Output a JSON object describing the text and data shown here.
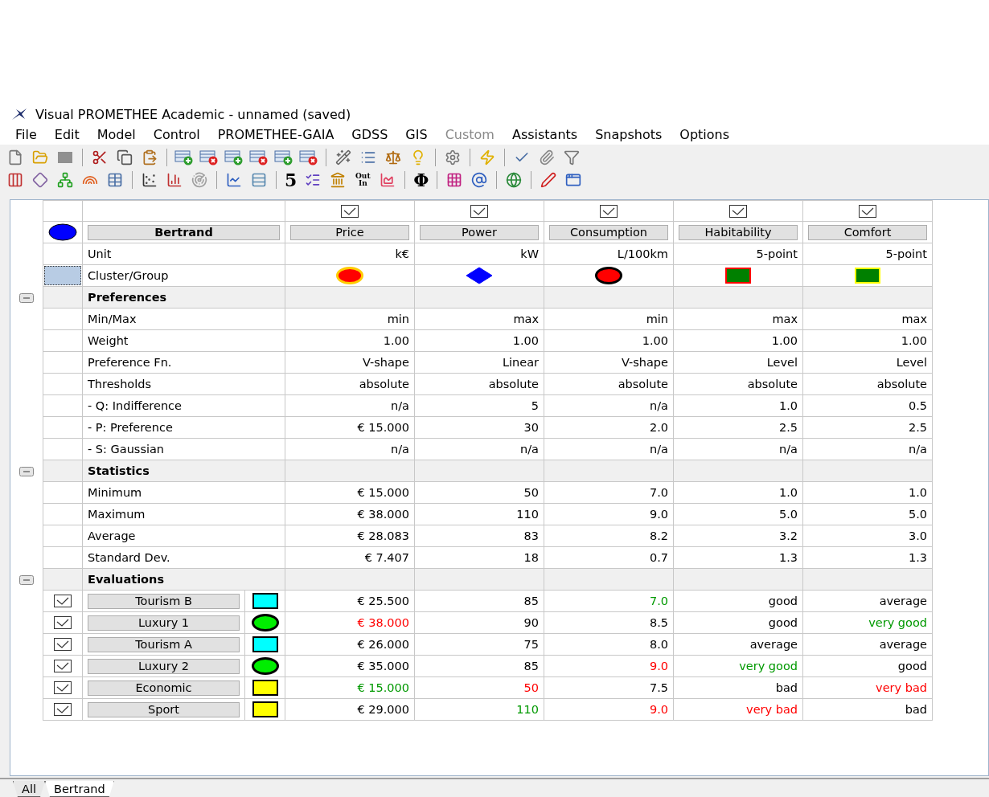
{
  "window": {
    "title": "Visual PROMETHEE Academic - unnamed (saved)"
  },
  "menu": [
    {
      "label": "File",
      "disabled": false
    },
    {
      "label": "Edit",
      "disabled": false
    },
    {
      "label": "Model",
      "disabled": false
    },
    {
      "label": "Control",
      "disabled": false
    },
    {
      "label": "PROMETHEE-GAIA",
      "disabled": false
    },
    {
      "label": "GDSS",
      "disabled": false
    },
    {
      "label": "GIS",
      "disabled": false
    },
    {
      "label": "Custom",
      "disabled": true
    },
    {
      "label": "Assistants",
      "disabled": false
    },
    {
      "label": "Snapshots",
      "disabled": false
    },
    {
      "label": "Options",
      "disabled": false
    }
  ],
  "toolbars": [
    [
      {
        "kind": "icon"
      },
      {
        "kind": "icon"
      },
      {
        "kind": "icon"
      },
      {
        "kind": "separator"
      },
      {
        "kind": "icon"
      },
      {
        "kind": "icon"
      },
      {
        "kind": "icon"
      },
      {
        "kind": "separator"
      },
      {
        "kind": "icon"
      },
      {
        "kind": "icon"
      },
      {
        "kind": "icon"
      },
      {
        "kind": "icon"
      },
      {
        "kind": "icon"
      },
      {
        "kind": "icon"
      },
      {
        "kind": "separator"
      },
      {
        "kind": "icon"
      },
      {
        "kind": "icon"
      },
      {
        "kind": "icon"
      },
      {
        "kind": "icon"
      },
      {
        "kind": "separator"
      },
      {
        "kind": "icon"
      },
      {
        "kind": "separator"
      },
      {
        "kind": "icon"
      },
      {
        "kind": "separator"
      },
      {
        "kind": "icon"
      },
      {
        "kind": "icon"
      },
      {
        "kind": "icon"
      }
    ],
    [
      {
        "kind": "icon"
      },
      {
        "kind": "icon"
      },
      {
        "kind": "icon"
      },
      {
        "kind": "icon"
      },
      {
        "kind": "icon"
      },
      {
        "kind": "separator"
      },
      {
        "kind": "icon"
      },
      {
        "kind": "icon"
      },
      {
        "kind": "icon"
      },
      {
        "kind": "separator"
      },
      {
        "kind": "icon"
      },
      {
        "kind": "icon"
      },
      {
        "kind": "separator"
      },
      {
        "kind": "glyph",
        "label": "5"
      },
      {
        "kind": "icon"
      },
      {
        "kind": "icon"
      },
      {
        "kind": "glyph",
        "label": "Out In"
      },
      {
        "kind": "icon"
      },
      {
        "kind": "separator"
      },
      {
        "kind": "glyph",
        "label": "Φ"
      },
      {
        "kind": "separator"
      },
      {
        "kind": "icon"
      },
      {
        "kind": "icon"
      },
      {
        "kind": "separator"
      },
      {
        "kind": "icon"
      },
      {
        "kind": "separator"
      },
      {
        "kind": "icon"
      },
      {
        "kind": "icon"
      }
    ]
  ],
  "scenario": {
    "name": "Bertrand",
    "color": "#0000ff"
  },
  "unit_label": "Unit",
  "cluster_label": "Cluster/Group",
  "criteria": [
    {
      "name": "Price",
      "checked": true,
      "unit": "k€",
      "cluster": {
        "kind": "circle",
        "color": "#ff0000",
        "outline": {
          "color": "#ffcc00"
        }
      }
    },
    {
      "name": "Power",
      "checked": true,
      "unit": "kW",
      "cluster": {
        "kind": "diamond",
        "color": "#0000ff",
        "outline": {
          "color": "#0000ff"
        }
      }
    },
    {
      "name": "Consumption",
      "checked": true,
      "unit": "L/100km",
      "cluster": {
        "kind": "circle",
        "color": "#ff0000",
        "outline": {
          "color": "#000000"
        }
      }
    },
    {
      "name": "Habitability",
      "checked": true,
      "unit": "5-point",
      "cluster": {
        "kind": "square",
        "color": "#008000",
        "outline": {
          "color": "#ff0000"
        }
      }
    },
    {
      "name": "Comfort",
      "checked": true,
      "unit": "5-point",
      "cluster": {
        "kind": "square",
        "color": "#008000",
        "outline": {
          "color": "#ffff00"
        }
      }
    }
  ],
  "sections": [
    {
      "title": "Preferences",
      "expanded": true,
      "rows": [
        {
          "label": "Min/Max",
          "cells": [
            "min",
            "max",
            "min",
            "max",
            "max"
          ]
        },
        {
          "label": "Weight",
          "cells": [
            "1.00",
            "1.00",
            "1.00",
            "1.00",
            "1.00"
          ]
        },
        {
          "label": "Preference Fn.",
          "cells": [
            "V-shape",
            "Linear",
            "V-shape",
            "Level",
            "Level"
          ]
        },
        {
          "label": "Thresholds",
          "cells": [
            "absolute",
            "absolute",
            "absolute",
            "absolute",
            "absolute"
          ]
        },
        {
          "label": "- Q: Indifference",
          "cells": [
            "n/a",
            "5",
            "n/a",
            "1.0",
            "0.5"
          ]
        },
        {
          "label": "- P: Preference",
          "cells": [
            "€ 15.000",
            "30",
            "2.0",
            "2.5",
            "2.5"
          ]
        },
        {
          "label": "- S: Gaussian",
          "cells": [
            "n/a",
            "n/a",
            "n/a",
            "n/a",
            "n/a"
          ]
        }
      ]
    },
    {
      "title": "Statistics",
      "expanded": true,
      "rows": [
        {
          "label": "Minimum",
          "cells": [
            "€ 15.000",
            "50",
            "7.0",
            "1.0",
            "1.0"
          ]
        },
        {
          "label": "Maximum",
          "cells": [
            "€ 38.000",
            "110",
            "9.0",
            "5.0",
            "5.0"
          ]
        },
        {
          "label": "Average",
          "cells": [
            "€ 28.083",
            "83",
            "8.2",
            "3.2",
            "3.0"
          ]
        },
        {
          "label": "Standard Dev.",
          "cells": [
            "€ 7.407",
            "18",
            "0.7",
            "1.3",
            "1.3"
          ]
        }
      ]
    },
    {
      "title": "Evaluations",
      "expanded": true,
      "alternatives": [
        {
          "name": "Tourism B",
          "checked": true,
          "kind": "square",
          "color": "#00ffff",
          "cells": [
            "€ 25.500",
            "85",
            {
              "text": "7.0",
              "color": "#009900"
            },
            "good",
            "average"
          ]
        },
        {
          "name": "Luxury 1",
          "checked": true,
          "kind": "circle",
          "color": "#00ee00",
          "cells": [
            {
              "text": "€ 38.000",
              "color": "#ff0000"
            },
            "90",
            "8.5",
            "good",
            {
              "text": "very good",
              "color": "#009900"
            }
          ]
        },
        {
          "name": "Tourism A",
          "checked": true,
          "kind": "square",
          "color": "#00ffff",
          "cells": [
            "€ 26.000",
            "75",
            "8.0",
            "average",
            "average"
          ]
        },
        {
          "name": "Luxury 2",
          "checked": true,
          "kind": "circle",
          "color": "#00ee00",
          "cells": [
            "€ 35.000",
            "85",
            {
              "text": "9.0",
              "color": "#ff0000"
            },
            {
              "text": "very good",
              "color": "#009900"
            },
            "good"
          ]
        },
        {
          "name": "Economic",
          "checked": true,
          "kind": "square",
          "color": "#ffff00",
          "cells": [
            {
              "text": "€ 15.000",
              "color": "#009900"
            },
            {
              "text": "50",
              "color": "#ff0000"
            },
            "7.5",
            "bad",
            {
              "text": "very bad",
              "color": "#ff0000"
            }
          ]
        },
        {
          "name": "Sport",
          "checked": true,
          "kind": "square",
          "color": "#ffff00",
          "cells": [
            "€ 29.000",
            {
              "text": "110",
              "color": "#009900"
            },
            {
              "text": "9.0",
              "color": "#ff0000"
            },
            {
              "text": "very bad",
              "color": "#ff0000"
            },
            "bad"
          ]
        }
      ]
    }
  ],
  "sheet_tabs": [
    {
      "label": "All",
      "selected": false
    },
    {
      "label": "Bertrand",
      "selected": true
    }
  ]
}
